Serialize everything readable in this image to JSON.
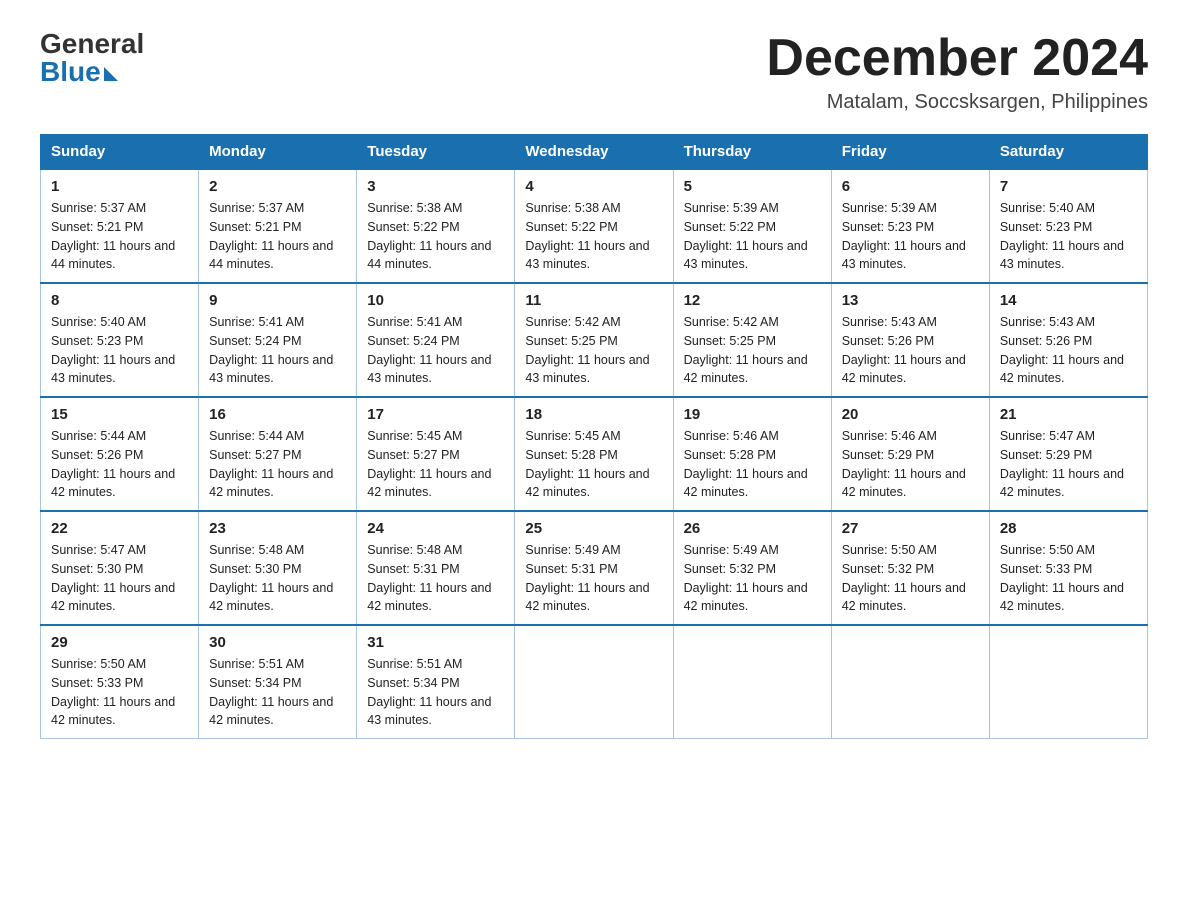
{
  "logo": {
    "general": "General",
    "blue": "Blue"
  },
  "title": "December 2024",
  "location": "Matalam, Soccsksargen, Philippines",
  "days_of_week": [
    "Sunday",
    "Monday",
    "Tuesday",
    "Wednesday",
    "Thursday",
    "Friday",
    "Saturday"
  ],
  "weeks": [
    [
      {
        "day": "1",
        "sunrise": "5:37 AM",
        "sunset": "5:21 PM",
        "daylight": "11 hours and 44 minutes."
      },
      {
        "day": "2",
        "sunrise": "5:37 AM",
        "sunset": "5:21 PM",
        "daylight": "11 hours and 44 minutes."
      },
      {
        "day": "3",
        "sunrise": "5:38 AM",
        "sunset": "5:22 PM",
        "daylight": "11 hours and 44 minutes."
      },
      {
        "day": "4",
        "sunrise": "5:38 AM",
        "sunset": "5:22 PM",
        "daylight": "11 hours and 43 minutes."
      },
      {
        "day": "5",
        "sunrise": "5:39 AM",
        "sunset": "5:22 PM",
        "daylight": "11 hours and 43 minutes."
      },
      {
        "day": "6",
        "sunrise": "5:39 AM",
        "sunset": "5:23 PM",
        "daylight": "11 hours and 43 minutes."
      },
      {
        "day": "7",
        "sunrise": "5:40 AM",
        "sunset": "5:23 PM",
        "daylight": "11 hours and 43 minutes."
      }
    ],
    [
      {
        "day": "8",
        "sunrise": "5:40 AM",
        "sunset": "5:23 PM",
        "daylight": "11 hours and 43 minutes."
      },
      {
        "day": "9",
        "sunrise": "5:41 AM",
        "sunset": "5:24 PM",
        "daylight": "11 hours and 43 minutes."
      },
      {
        "day": "10",
        "sunrise": "5:41 AM",
        "sunset": "5:24 PM",
        "daylight": "11 hours and 43 minutes."
      },
      {
        "day": "11",
        "sunrise": "5:42 AM",
        "sunset": "5:25 PM",
        "daylight": "11 hours and 43 minutes."
      },
      {
        "day": "12",
        "sunrise": "5:42 AM",
        "sunset": "5:25 PM",
        "daylight": "11 hours and 42 minutes."
      },
      {
        "day": "13",
        "sunrise": "5:43 AM",
        "sunset": "5:26 PM",
        "daylight": "11 hours and 42 minutes."
      },
      {
        "day": "14",
        "sunrise": "5:43 AM",
        "sunset": "5:26 PM",
        "daylight": "11 hours and 42 minutes."
      }
    ],
    [
      {
        "day": "15",
        "sunrise": "5:44 AM",
        "sunset": "5:26 PM",
        "daylight": "11 hours and 42 minutes."
      },
      {
        "day": "16",
        "sunrise": "5:44 AM",
        "sunset": "5:27 PM",
        "daylight": "11 hours and 42 minutes."
      },
      {
        "day": "17",
        "sunrise": "5:45 AM",
        "sunset": "5:27 PM",
        "daylight": "11 hours and 42 minutes."
      },
      {
        "day": "18",
        "sunrise": "5:45 AM",
        "sunset": "5:28 PM",
        "daylight": "11 hours and 42 minutes."
      },
      {
        "day": "19",
        "sunrise": "5:46 AM",
        "sunset": "5:28 PM",
        "daylight": "11 hours and 42 minutes."
      },
      {
        "day": "20",
        "sunrise": "5:46 AM",
        "sunset": "5:29 PM",
        "daylight": "11 hours and 42 minutes."
      },
      {
        "day": "21",
        "sunrise": "5:47 AM",
        "sunset": "5:29 PM",
        "daylight": "11 hours and 42 minutes."
      }
    ],
    [
      {
        "day": "22",
        "sunrise": "5:47 AM",
        "sunset": "5:30 PM",
        "daylight": "11 hours and 42 minutes."
      },
      {
        "day": "23",
        "sunrise": "5:48 AM",
        "sunset": "5:30 PM",
        "daylight": "11 hours and 42 minutes."
      },
      {
        "day": "24",
        "sunrise": "5:48 AM",
        "sunset": "5:31 PM",
        "daylight": "11 hours and 42 minutes."
      },
      {
        "day": "25",
        "sunrise": "5:49 AM",
        "sunset": "5:31 PM",
        "daylight": "11 hours and 42 minutes."
      },
      {
        "day": "26",
        "sunrise": "5:49 AM",
        "sunset": "5:32 PM",
        "daylight": "11 hours and 42 minutes."
      },
      {
        "day": "27",
        "sunrise": "5:50 AM",
        "sunset": "5:32 PM",
        "daylight": "11 hours and 42 minutes."
      },
      {
        "day": "28",
        "sunrise": "5:50 AM",
        "sunset": "5:33 PM",
        "daylight": "11 hours and 42 minutes."
      }
    ],
    [
      {
        "day": "29",
        "sunrise": "5:50 AM",
        "sunset": "5:33 PM",
        "daylight": "11 hours and 42 minutes."
      },
      {
        "day": "30",
        "sunrise": "5:51 AM",
        "sunset": "5:34 PM",
        "daylight": "11 hours and 42 minutes."
      },
      {
        "day": "31",
        "sunrise": "5:51 AM",
        "sunset": "5:34 PM",
        "daylight": "11 hours and 43 minutes."
      },
      null,
      null,
      null,
      null
    ]
  ],
  "labels": {
    "sunrise": "Sunrise:",
    "sunset": "Sunset:",
    "daylight": "Daylight:"
  }
}
